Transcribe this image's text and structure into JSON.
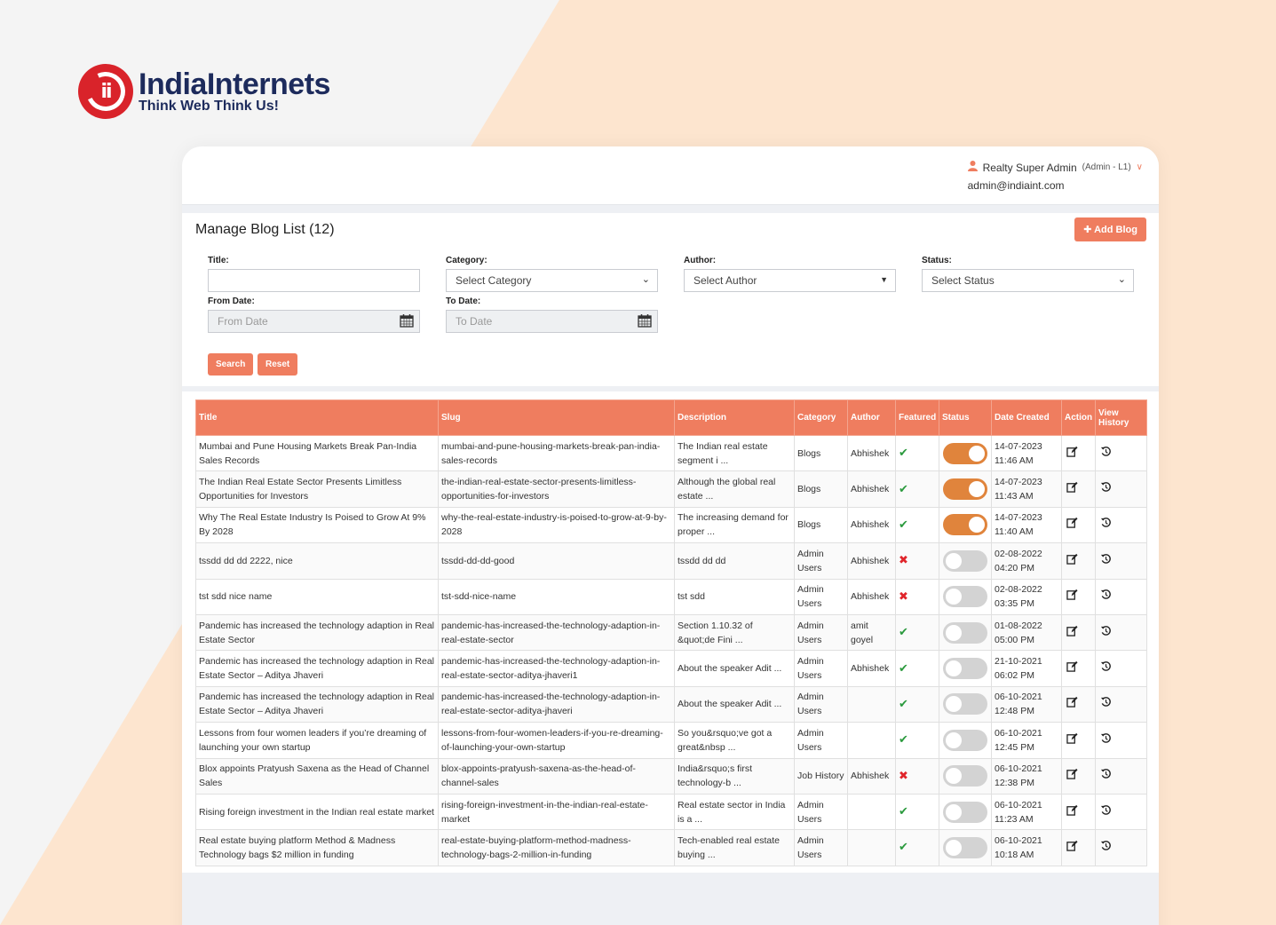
{
  "brand": {
    "name": "IndiaInternets",
    "tagline": "Think Web Think Us!",
    "primary_color": "#ef7d5f",
    "logo_color": "#d9232a"
  },
  "header": {
    "user_name": "Realty Super Admin",
    "user_role": "(Admin - L1)",
    "user_email": "admin@indiaint.com"
  },
  "page": {
    "title": "Manage Blog List (12)",
    "add_label": "Add Blog"
  },
  "filters": {
    "title_label": "Title:",
    "title_value": "",
    "category_label": "Category:",
    "category_value": "Select Category",
    "author_label": "Author:",
    "author_value": "Select Author",
    "status_label": "Status:",
    "status_value": "Select Status",
    "from_label": "From Date:",
    "from_placeholder": "From Date",
    "to_label": "To Date:",
    "to_placeholder": "To Date",
    "search_label": "Search",
    "reset_label": "Reset"
  },
  "table": {
    "columns": [
      "Title",
      "Slug",
      "Description",
      "Category",
      "Author",
      "Featured",
      "Status",
      "Date Created",
      "Action",
      "View History"
    ],
    "rows": [
      {
        "title": "Mumbai and Pune Housing Markets Break Pan-India Sales Records",
        "slug": "mumbai-and-pune-housing-markets-break-pan-india-sales-records",
        "description": "The Indian real estate segment i ...",
        "category": "Blogs",
        "author": "Abhishek",
        "featured": true,
        "status": true,
        "date": "14-07-2023",
        "time": "11:46 AM"
      },
      {
        "title": "The Indian Real Estate Sector Presents Limitless Opportunities for Investors",
        "slug": "the-indian-real-estate-sector-presents-limitless-opportunities-for-investors",
        "description": "Although the global real estate ...",
        "category": "Blogs",
        "author": "Abhishek",
        "featured": true,
        "status": true,
        "date": "14-07-2023",
        "time": "11:43 AM"
      },
      {
        "title": "Why The Real Estate Industry Is Poised to Grow At 9% By 2028",
        "slug": "why-the-real-estate-industry-is-poised-to-grow-at-9-by-2028",
        "description": "The increasing demand for proper ...",
        "category": "Blogs",
        "author": "Abhishek",
        "featured": true,
        "status": true,
        "date": "14-07-2023",
        "time": "11:40 AM"
      },
      {
        "title": "tssdd dd dd 2222, nice",
        "slug": "tssdd-dd-dd-good",
        "description": "tssdd dd dd",
        "category": "Admin Users",
        "author": "Abhishek",
        "featured": false,
        "status": false,
        "date": "02-08-2022",
        "time": "04:20 PM"
      },
      {
        "title": "tst sdd nice name",
        "slug": "tst-sdd-nice-name",
        "description": "tst sdd",
        "category": "Admin Users",
        "author": "Abhishek",
        "featured": false,
        "status": false,
        "date": "02-08-2022",
        "time": "03:35 PM"
      },
      {
        "title": "Pandemic has increased the technology adaption in Real Estate Sector",
        "slug": "pandemic-has-increased-the-technology-adaption-in-real-estate-sector",
        "description": "Section 1.10.32 of &quot;de Fini ...",
        "category": "Admin Users",
        "author": "amit goyel",
        "featured": true,
        "status": false,
        "date": "01-08-2022",
        "time": "05:00 PM"
      },
      {
        "title": "Pandemic has increased the technology adaption in Real Estate Sector – Aditya Jhaveri",
        "slug": "pandemic-has-increased-the-technology-adaption-in-real-estate-sector-aditya-jhaveri1",
        "description": "About the speaker Adit ...",
        "category": "Admin Users",
        "author": "Abhishek",
        "featured": true,
        "status": false,
        "date": "21-10-2021",
        "time": "06:02 PM"
      },
      {
        "title": "Pandemic has increased the technology adaption in Real Estate Sector – Aditya Jhaveri",
        "slug": "pandemic-has-increased-the-technology-adaption-in-real-estate-sector-aditya-jhaveri",
        "description": "About the speaker Adit ...",
        "category": "Admin Users",
        "author": "",
        "featured": true,
        "status": false,
        "date": "06-10-2021",
        "time": "12:48 PM"
      },
      {
        "title": "Lessons from four women leaders if you’re dreaming of launching your own startup",
        "slug": "lessons-from-four-women-leaders-if-you-re-dreaming-of-launching-your-own-startup",
        "description": "So you&rsquo;ve got a great&nbsp ...",
        "category": "Admin Users",
        "author": "",
        "featured": true,
        "status": false,
        "date": "06-10-2021",
        "time": "12:45 PM"
      },
      {
        "title": "Blox appoints Pratyush Saxena as the Head of Channel Sales",
        "slug": "blox-appoints-pratyush-saxena-as-the-head-of-channel-sales",
        "description": "India&rsquo;s first technology-b ...",
        "category": "Job History",
        "author": "Abhishek",
        "featured": false,
        "status": false,
        "date": "06-10-2021",
        "time": "12:38 PM"
      },
      {
        "title": "Rising foreign investment in the Indian real estate market",
        "slug": "rising-foreign-investment-in-the-indian-real-estate-market",
        "description": "Real estate sector in India is a ...",
        "category": "Admin Users",
        "author": "",
        "featured": true,
        "status": false,
        "date": "06-10-2021",
        "time": "11:23 AM"
      },
      {
        "title": "Real estate buying platform Method & Madness Technology bags $2 million in funding",
        "slug": "real-estate-buying-platform-method-madness-technology-bags-2-million-in-funding",
        "description": "Tech-enabled real estate buying ...",
        "category": "Admin Users",
        "author": "",
        "featured": true,
        "status": false,
        "date": "06-10-2021",
        "time": "10:18 AM"
      }
    ]
  }
}
